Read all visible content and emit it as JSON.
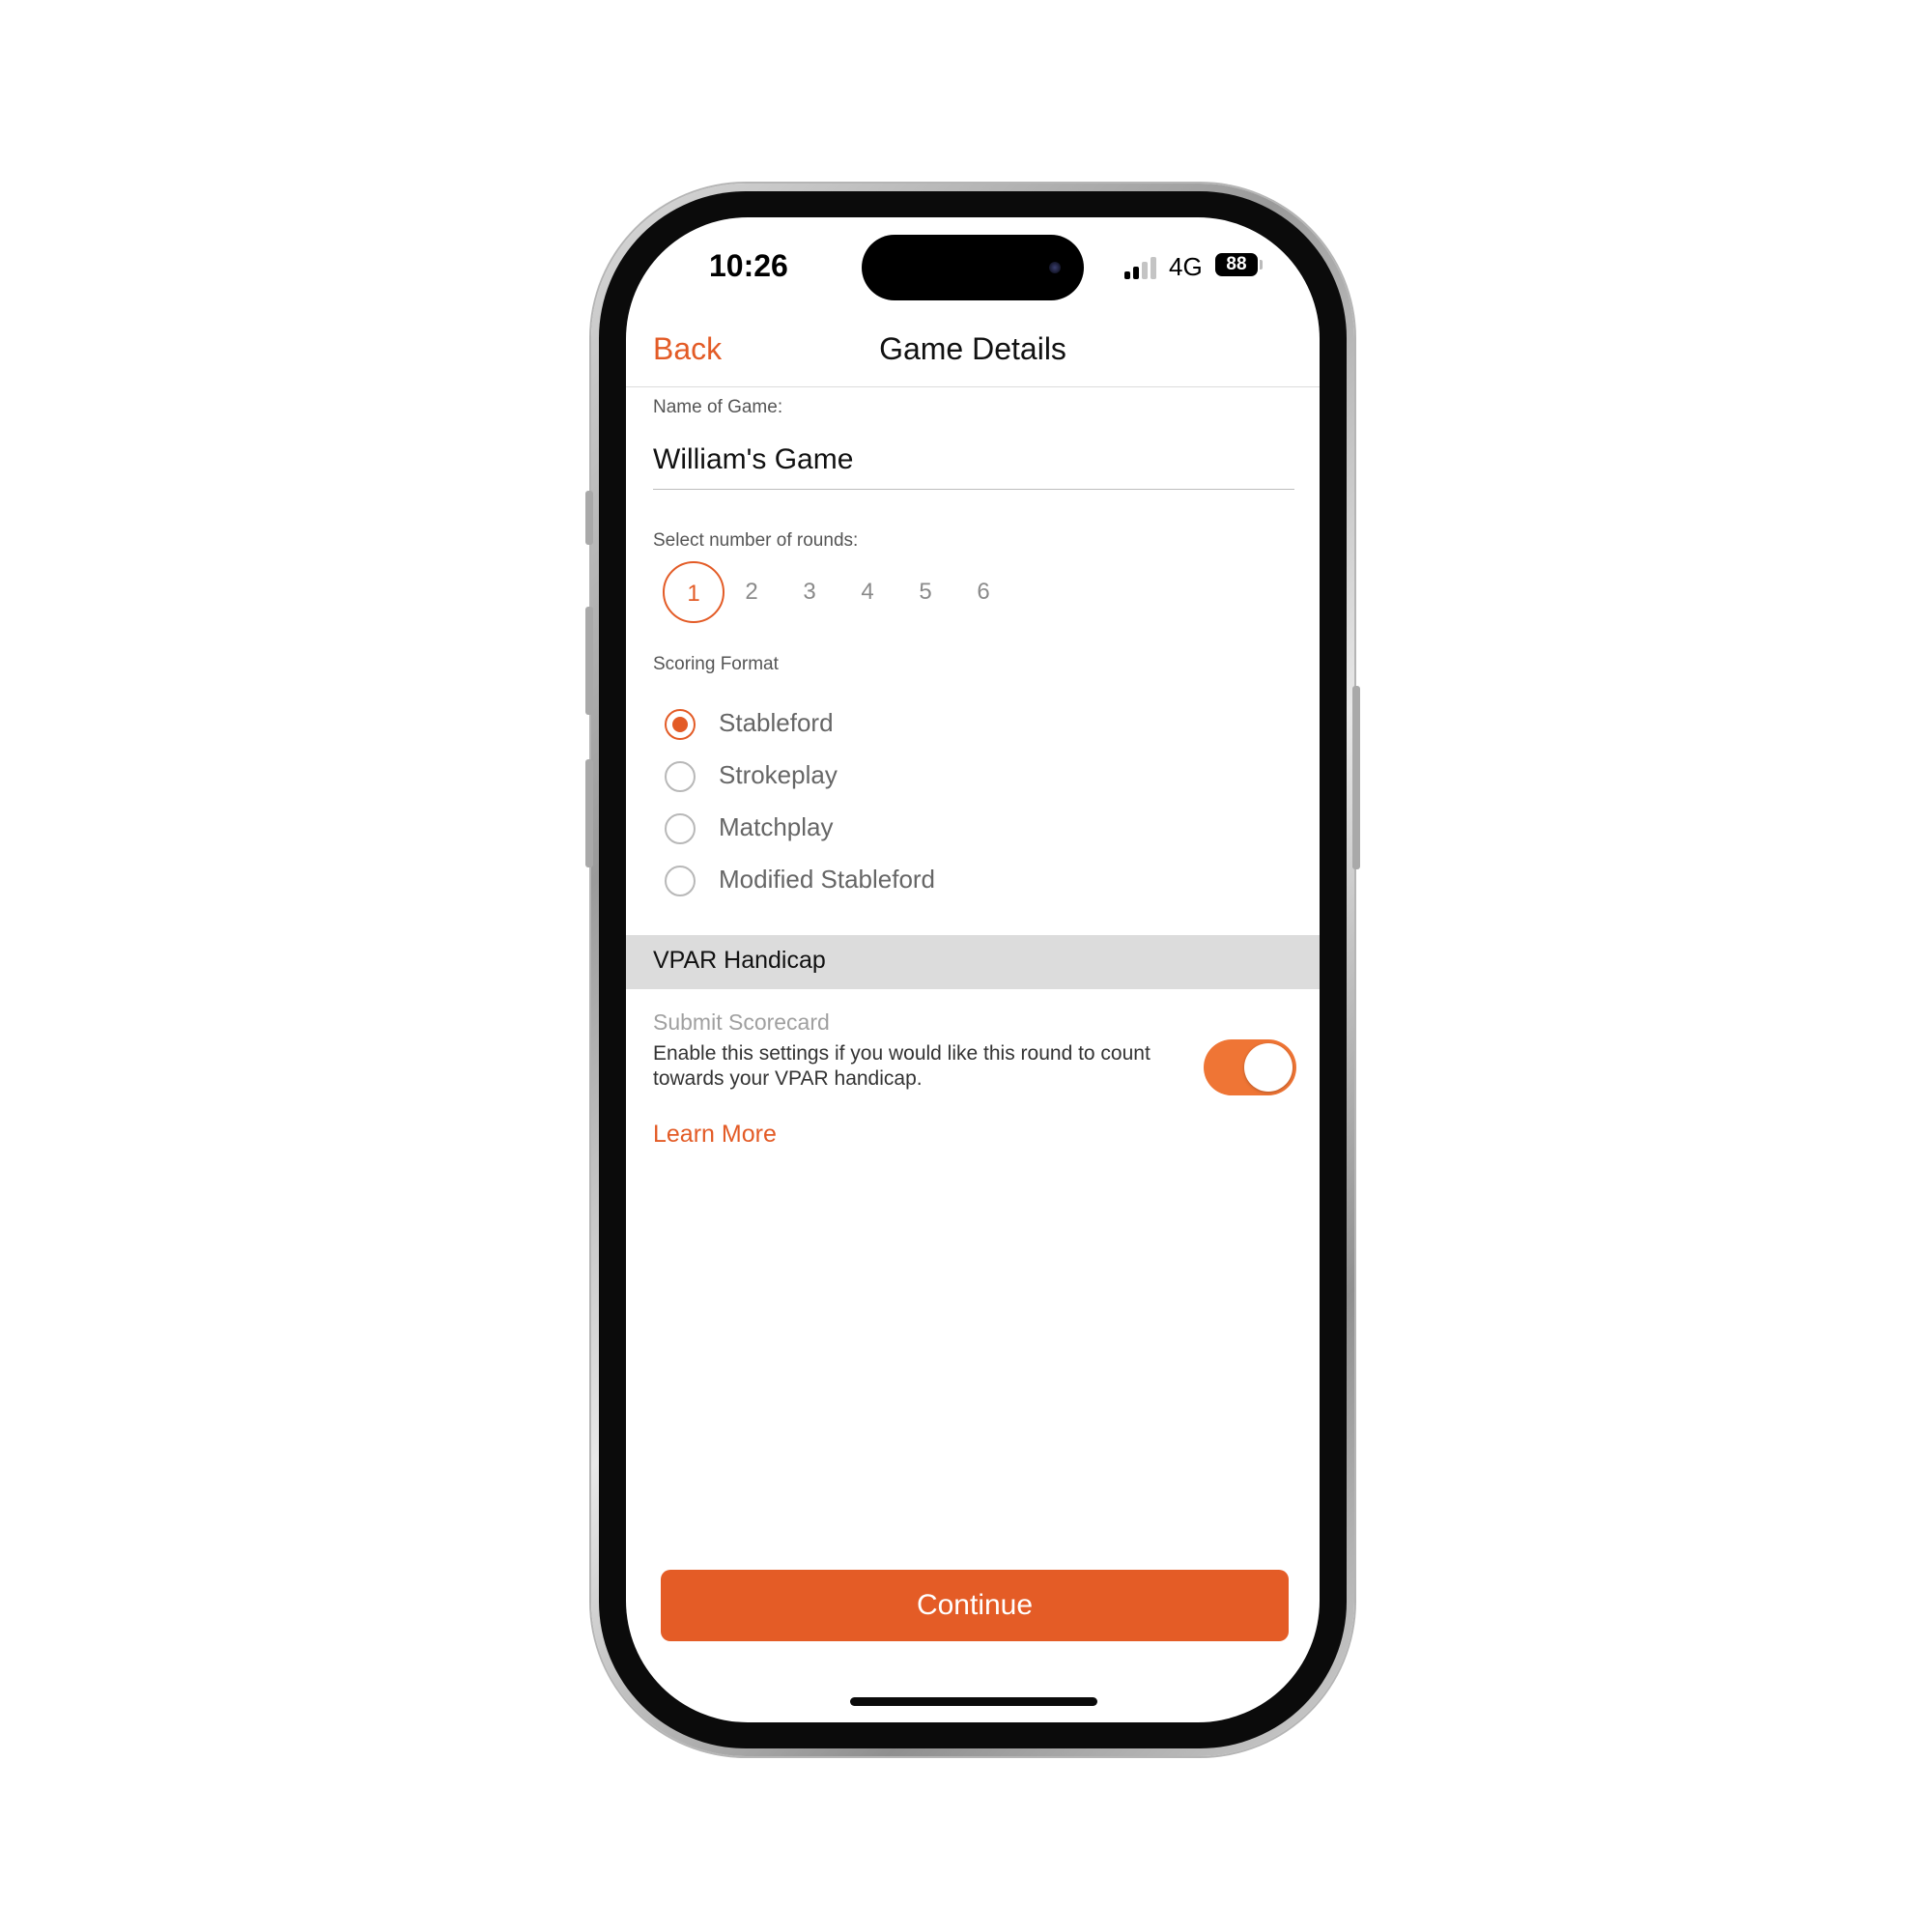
{
  "status_bar": {
    "time": "10:26",
    "network": "4G",
    "battery": "88",
    "signal_bars_active": 2,
    "signal_bars_total": 4
  },
  "nav": {
    "back_label": "Back",
    "title": "Game Details"
  },
  "form": {
    "name_label": "Name of Game:",
    "name_value": "William's Game",
    "rounds_label": "Select number of rounds:",
    "rounds": [
      "1",
      "2",
      "3",
      "4",
      "5",
      "6"
    ],
    "rounds_selected": "1",
    "scoring_label": "Scoring Format",
    "scoring_options": [
      "Stableford",
      "Strokeplay",
      "Matchplay",
      "Modified Stableford"
    ],
    "scoring_selected": "Stableford"
  },
  "handicap": {
    "section_title": "VPAR Handicap",
    "submit_title": "Submit Scorecard",
    "submit_description": "Enable this settings if you would like this round to count towards your VPAR handicap.",
    "toggle_on": true,
    "learn_more": "Learn More"
  },
  "actions": {
    "continue_label": "Continue"
  },
  "colors": {
    "accent": "#e35b26",
    "toggle_on": "#ef7535",
    "section_bg": "#dcdcdc"
  }
}
